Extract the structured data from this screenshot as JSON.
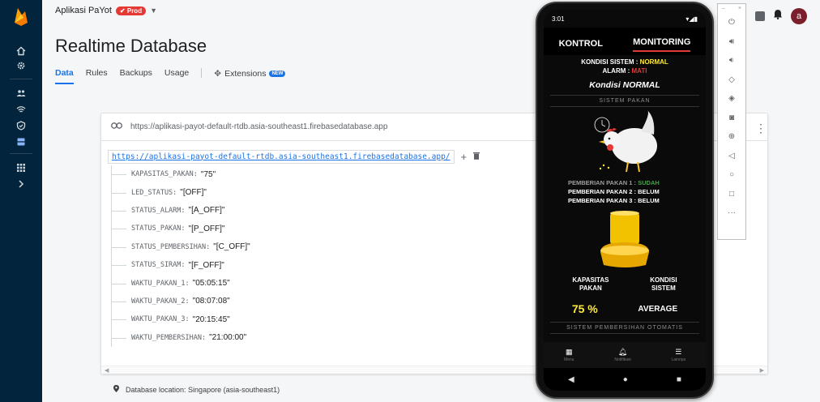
{
  "header": {
    "project_name": "Aplikasi PaYot",
    "env_badge": "Prod",
    "title": "Realtime Database",
    "tabs": [
      {
        "label": "Data"
      },
      {
        "label": "Rules"
      },
      {
        "label": "Backups"
      },
      {
        "label": "Usage"
      },
      {
        "label": "Extensions"
      }
    ],
    "new_badge": "NEW",
    "avatar_letter": "a"
  },
  "database": {
    "url": "https://aplikasi-payot-default-rtdb.asia-southeast1.firebasedatabase.app",
    "root_link": "https://aplikasi-payot-default-rtdb.asia-southeast1.firebasedatabase.app/",
    "nodes": [
      {
        "key": "KAPASITAS_PAKAN:",
        "value": "\"75\""
      },
      {
        "key": "LED_STATUS:",
        "value": "\"[OFF]\""
      },
      {
        "key": "STATUS_ALARM:",
        "value": "\"[A_OFF]\""
      },
      {
        "key": "STATUS_PAKAN:",
        "value": "\"[P_OFF]\""
      },
      {
        "key": "STATUS_PEMBERSIHAN:",
        "value": "\"[C_OFF]\""
      },
      {
        "key": "STATUS_SIRAM:",
        "value": "\"[F_OFF]\""
      },
      {
        "key": "WAKTU_PAKAN_1:",
        "value": "\"05:05:15\""
      },
      {
        "key": "WAKTU_PAKAN_2:",
        "value": "\"08:07:08\""
      },
      {
        "key": "WAKTU_PAKAN_3:",
        "value": "\"20:15:45\""
      },
      {
        "key": "WAKTU_PEMBERSIHAN:",
        "value": "\"21:00:00\""
      }
    ],
    "location": "Database location: Singapore (asia-southeast1)"
  },
  "phone": {
    "status_time": "3:01",
    "tab_kontrol": "KONTROL",
    "tab_monitoring": "MONITORING",
    "kondisi_label": "KONDISI SISTEM : ",
    "kondisi_value": "NORMAL",
    "alarm_label": "ALARM : ",
    "alarm_value": "MATI",
    "kondisi_banner": "Kondisi NORMAL",
    "section_pakan": "SISTEM PAKAN",
    "pemberian": [
      {
        "label": "PEMBERIAN PAKAN 1 : ",
        "value": "SUDAH"
      },
      {
        "label": "PEMBERIAN PAKAN 2 : ",
        "value": "BELUM"
      },
      {
        "label": "PEMBERIAN PAKAN 3 : ",
        "value": "BELUM"
      }
    ],
    "kapasitas_label_1": "KAPASITAS",
    "kapasitas_label_2": "PAKAN",
    "kondisi_sistem_label_1": "KONDISI",
    "kondisi_sistem_label_2": "SISTEM",
    "kapasitas_value": "75 %",
    "kondisi_sistem_value": "AVERAGE",
    "section_pembersihan": "SISTEM PEMBERSIHAN OTOMATIS",
    "nav": [
      {
        "label": "Menu"
      },
      {
        "label": "Notifikasi"
      },
      {
        "label": "Lainnya"
      }
    ]
  },
  "colors": {
    "rail": "#03243d",
    "accent": "#1a73e8",
    "prod_badge": "#e53935",
    "phone_yellow": "#ffeb3b",
    "phone_red": "#e53935",
    "phone_green": "#43a047"
  }
}
